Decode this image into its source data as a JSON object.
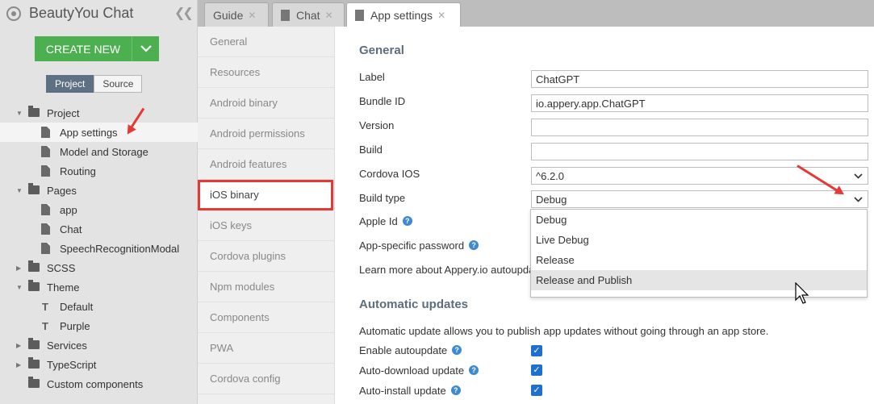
{
  "app": {
    "title": "BeautyYou Chat",
    "collapse_icon": "double-chevron-left-icon"
  },
  "create_button": {
    "label": "CREATE NEW",
    "color": "#4caf50"
  },
  "view_toggle": {
    "project": "Project",
    "source": "Source"
  },
  "tree": {
    "project": "Project",
    "app_settings": "App settings",
    "model_and_storage": "Model and Storage",
    "routing": "Routing",
    "pages": "Pages",
    "page_app": "app",
    "page_chat": "Chat",
    "page_speech": "SpeechRecognitionModal",
    "scss": "SCSS",
    "theme": "Theme",
    "theme_default": "Default",
    "theme_purple": "Purple",
    "services": "Services",
    "typescript": "TypeScript",
    "custom_components": "Custom components"
  },
  "tabs": {
    "guide": "Guide",
    "chat": "Chat",
    "app_settings": "App settings"
  },
  "settings_nav": {
    "general": "General",
    "resources": "Resources",
    "android_binary": "Android binary",
    "android_permissions": "Android permissions",
    "android_features": "Android features",
    "ios_binary": "iOS binary",
    "ios_keys": "iOS keys",
    "cordova_plugins": "Cordova plugins",
    "npm_modules": "Npm modules",
    "components": "Components",
    "pwa": "PWA",
    "cordova_config": "Cordova config"
  },
  "general": {
    "heading": "General",
    "label_label": "Label",
    "label_value": "ChatGPT",
    "bundle_id_label": "Bundle ID",
    "bundle_id_value": "io.appery.app.ChatGPT",
    "version_label": "Version",
    "version_value": "",
    "build_label": "Build",
    "build_value": "",
    "cordova_ios_label": "Cordova IOS",
    "cordova_ios_value": "^6.2.0",
    "build_type_label": "Build type",
    "build_type_value": "Debug",
    "apple_id_label": "Apple Id",
    "app_password_label": "App-specific password",
    "learn_more": "Learn more about Appery.io autoupda"
  },
  "build_type_options": [
    "Debug",
    "Live Debug",
    "Release",
    "Release and Publish"
  ],
  "build_type_hovered": "Release and Publish",
  "auto_updates": {
    "heading": "Automatic updates",
    "description": "Automatic update allows you to publish app updates without going through an app store.",
    "enable_label": "Enable autoupdate",
    "enable_checked": true,
    "download_label": "Auto-download update",
    "download_checked": true,
    "install_label": "Auto-install update",
    "install_checked": true
  },
  "colors": {
    "annotation": "#e53935",
    "heading": "#5d6d7e",
    "checkbox": "#1e6fd0"
  }
}
